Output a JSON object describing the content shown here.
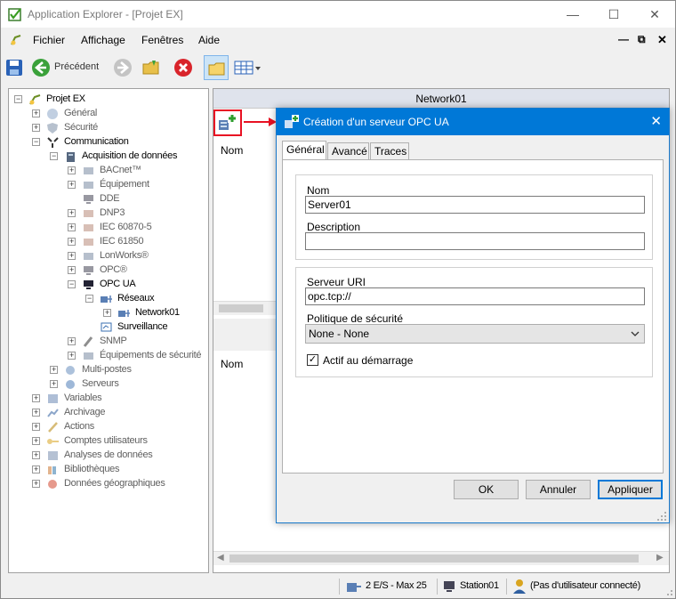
{
  "window": {
    "title": "Application Explorer - [Projet EX]"
  },
  "menu": {
    "items": [
      "Fichier",
      "Affichage",
      "Fenêtres",
      "Aide"
    ]
  },
  "toolbar": {
    "back_label": "Précédent"
  },
  "tree": {
    "root": "Projet EX",
    "nodes": [
      "Général",
      "Sécurité",
      "Communication",
      "Acquisition de données",
      "BACnet™",
      "Équipement",
      "DDE",
      "DNP3",
      "IEC 60870-5",
      "IEC 61850",
      "LonWorks®",
      "OPC®",
      "OPC UA",
      "Réseaux",
      "Network01",
      "Surveillance",
      "SNMP",
      "Équipements de sécurité",
      "Multi-postes",
      "Serveurs",
      "Variables",
      "Archivage",
      "Actions",
      "Comptes utilisateurs",
      "Analyses de données",
      "Bibliothèques",
      "Données géographiques"
    ]
  },
  "right_panel": {
    "header": "Network01",
    "col_name_top": "Nom",
    "col_name_bottom": "Nom"
  },
  "dialog": {
    "title": "Création d'un serveur OPC UA",
    "tabs": [
      "Général",
      "Avancé",
      "Traces"
    ],
    "name_label": "Nom",
    "name_value": "Server01",
    "description_label": "Description",
    "description_value": "",
    "uri_label": "Serveur URI",
    "uri_value": "opc.tcp://",
    "policy_label": "Politique de sécurité",
    "policy_value": "None - None",
    "active_label": "Actif au démarrage",
    "active_checked": true,
    "ok": "OK",
    "cancel": "Annuler",
    "apply": "Appliquer"
  },
  "status": {
    "io": "2 E/S - Max 25",
    "station": "Station01",
    "user": "(Pas d'utilisateur connecté)"
  },
  "colors": {
    "accent": "#0078d7",
    "highlight_arrow": "#e81123"
  }
}
